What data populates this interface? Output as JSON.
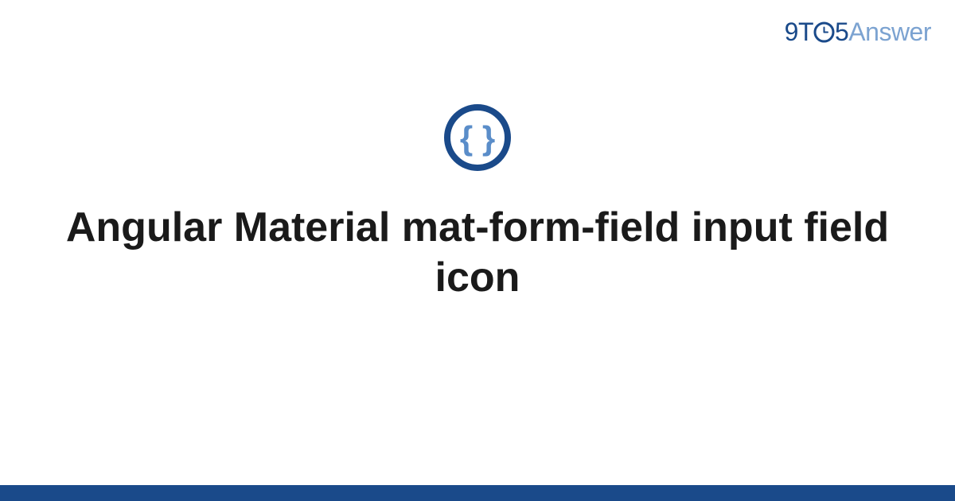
{
  "brand": {
    "part1": "9",
    "part2": "T",
    "part3": "5",
    "part4": "Answer"
  },
  "title": "Angular Material mat-form-field input field icon",
  "colors": {
    "brand_primary": "#1a4a8a",
    "brand_light": "#7ca3d1",
    "icon_ring": "#1a4a8a",
    "icon_brace": "#5a8dc9"
  }
}
